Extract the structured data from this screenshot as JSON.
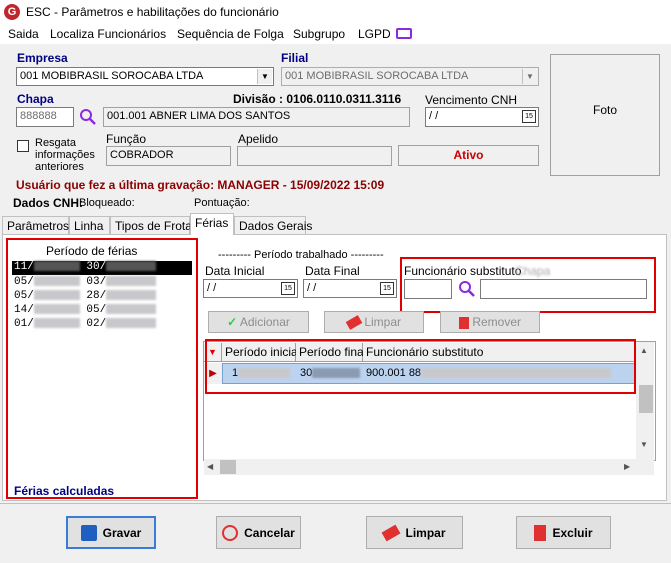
{
  "window": {
    "title": "ESC - Parâmetros e habilitações do funcionário"
  },
  "menu": [
    "Saida",
    "Localiza Funcionários",
    "Sequência de Folga",
    "Subgrupo",
    "LGPD"
  ],
  "form": {
    "empresa_label": "Empresa",
    "empresa_value": "001 MOBIBRASIL SOROCABA LTDA",
    "filial_label": "Filial",
    "filial_value": "001 MOBIBRASIL SOROCABA LTDA",
    "chapa_label": "Chapa",
    "chapa_value": "888888",
    "funcionario_value": "001.001 ABNER LIMA DOS SANTOS",
    "divisao_text": "Divisão : 0106.0110.0311.3116",
    "vencimento_label": "Vencimento  CNH",
    "vencimento_value": "/ /",
    "resgata_label": "Resgata informações anteriores",
    "funcao_label": "Função",
    "funcao_value": "COBRADOR",
    "apelido_label": "Apelido",
    "apelido_value": "",
    "status": "Ativo",
    "foto_label": "Foto",
    "last_save": "Usuário que fez a última gravação: MANAGER - 15/09/2022 15:09",
    "dados_cnh_label": "Dados CNH:",
    "bloqueado_label": "Bloqueado:",
    "pontuacao_label": "Pontuação:"
  },
  "tabs": [
    "Parâmetros",
    "Linha",
    "Tipos de Frota",
    "Férias",
    "Dados Gerais"
  ],
  "active_tab": "Férias",
  "ferias": {
    "list_header": "Período de férias",
    "list_rows": [
      {
        "a": "11/",
        "b": "30/"
      },
      {
        "a": "05/",
        "b": "03/"
      },
      {
        "a": "05/",
        "b": "28/"
      },
      {
        "a": "14/",
        "b": "05/"
      },
      {
        "a": "01/",
        "b": "02/"
      }
    ],
    "ferias_calculadas": "Férias calculadas",
    "periodo_trabalhado": "--------- Período trabalhado ---------",
    "data_inicial_label": "Data Inicial",
    "data_inicial_value": "/ /",
    "data_final_label": "Data Final",
    "data_final_value": "/ /",
    "substituto_label": "Funcionário substituto",
    "substituto_suffix": "Chapa",
    "substituto_value": "",
    "substituto_nome": "",
    "adicionar": "Adicionar",
    "limpar": "Limpar",
    "remover": "Remover",
    "grid_headers": [
      "Período inicial",
      "Período final",
      "Funcionário substituto"
    ],
    "grid_row": {
      "inicial": "1",
      "final": "30",
      "substituto": "900.001 88"
    }
  },
  "footer": {
    "gravar": "Gravar",
    "cancelar": "Cancelar",
    "limpar": "Limpar",
    "excluir": "Excluir"
  },
  "colors": {
    "accent_blue": "#000080",
    "warn_red": "#8b0000",
    "status_red": "#cc0000",
    "highlight_red": "#e00000",
    "selection": "#bcd3f0"
  }
}
